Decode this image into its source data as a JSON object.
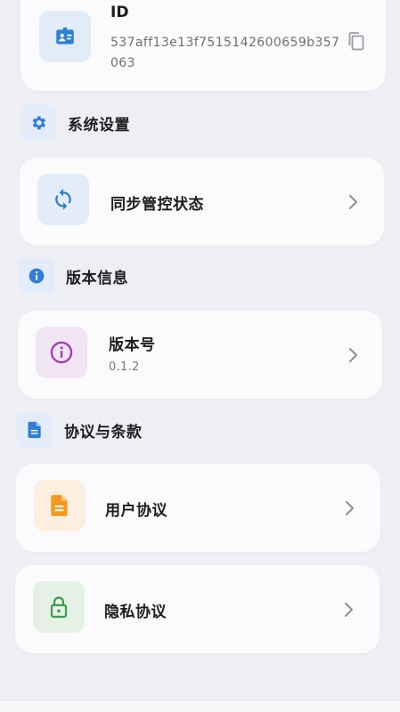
{
  "device_info": {
    "id_label": "ID",
    "id_value": "537aff13e13f7515142600659b357063"
  },
  "sections": {
    "system": {
      "title": "系统设置",
      "icon": "gear-icon"
    },
    "version": {
      "title": "版本信息",
      "icon": "info-icon"
    },
    "agreements": {
      "title": "协议与条款",
      "icon": "document-icon"
    }
  },
  "rows": {
    "sync": {
      "title": "同步管控状态",
      "icon": "sync-icon"
    },
    "version": {
      "title": "版本号",
      "value": "0.1.2",
      "icon": "info-circle-icon"
    },
    "user_agreement": {
      "title": "用户协议",
      "icon": "document-icon"
    },
    "privacy": {
      "title": "隐私协议",
      "icon": "lock-icon"
    }
  },
  "colors": {
    "accent_blue": "#2f7ed8",
    "version_purple": "#9b3fb0",
    "agreement_orange": "#f29a1f",
    "privacy_green": "#3f9a4c"
  }
}
